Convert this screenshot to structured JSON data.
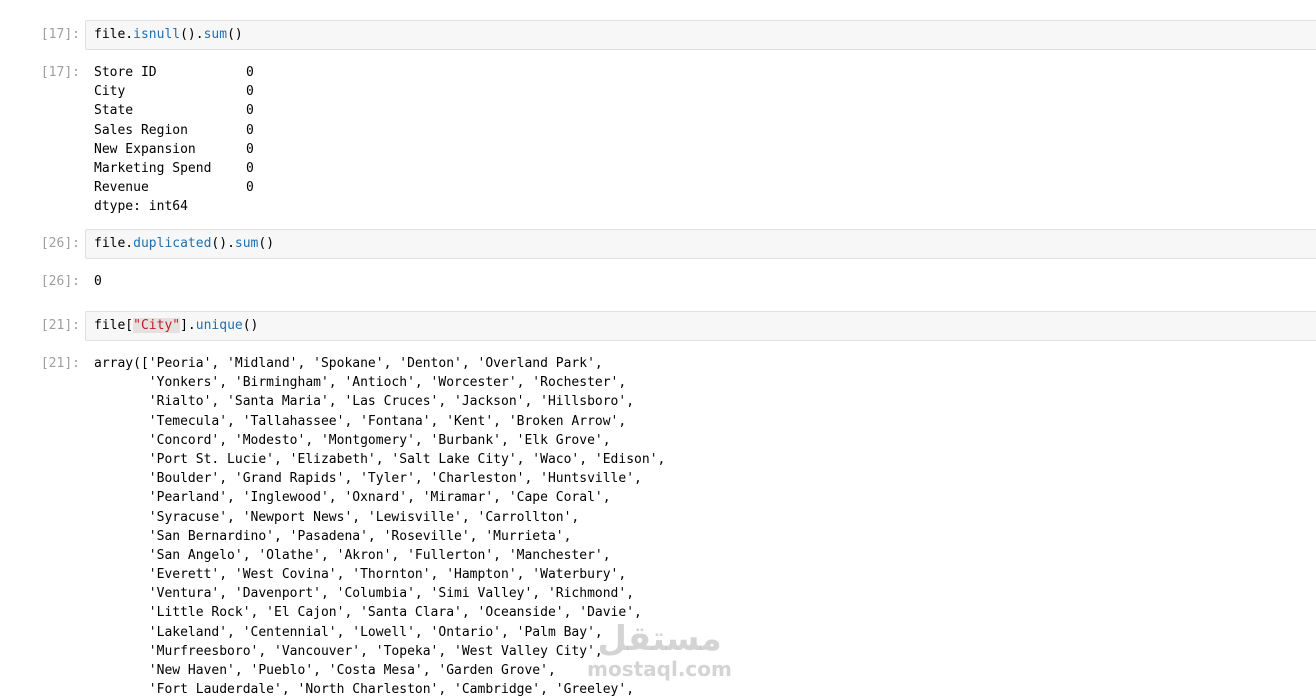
{
  "cells": [
    {
      "input_prompt": "[17]:",
      "input_code": {
        "obj": "file.",
        "fn1": "isnull",
        "mid": "().",
        "fn2": "sum",
        "end": "()"
      },
      "output_prompt": "[17]:",
      "output_rows": [
        {
          "name": "Store ID",
          "value": "0"
        },
        {
          "name": "City",
          "value": "0"
        },
        {
          "name": "State",
          "value": "0"
        },
        {
          "name": "Sales Region",
          "value": "0"
        },
        {
          "name": "New Expansion",
          "value": "0"
        },
        {
          "name": "Marketing Spend",
          "value": "0"
        },
        {
          "name": "Revenue",
          "value": "0"
        }
      ],
      "output_dtype": "dtype: int64"
    },
    {
      "input_prompt": "[26]:",
      "input_code": {
        "obj": "file.",
        "fn1": "duplicated",
        "mid": "().",
        "fn2": "sum",
        "end": "()"
      },
      "output_prompt": "[26]:",
      "output_value": "0"
    },
    {
      "input_prompt": "[21]:",
      "input_code": {
        "obj": "file[",
        "str": "\"City\"",
        "mid": "].",
        "fn": "unique",
        "end": "()"
      },
      "output_prompt": "[21]:",
      "output_lines": [
        "array(['Peoria', 'Midland', 'Spokane', 'Denton', 'Overland Park',",
        "       'Yonkers', 'Birmingham', 'Antioch', 'Worcester', 'Rochester',",
        "       'Rialto', 'Santa Maria', 'Las Cruces', 'Jackson', 'Hillsboro',",
        "       'Temecula', 'Tallahassee', 'Fontana', 'Kent', 'Broken Arrow',",
        "       'Concord', 'Modesto', 'Montgomery', 'Burbank', 'Elk Grove',",
        "       'Port St. Lucie', 'Elizabeth', 'Salt Lake City', 'Waco', 'Edison',",
        "       'Boulder', 'Grand Rapids', 'Tyler', 'Charleston', 'Huntsville',",
        "       'Pearland', 'Inglewood', 'Oxnard', 'Miramar', 'Cape Coral',",
        "       'Syracuse', 'Newport News', 'Lewisville', 'Carrollton',",
        "       'San Bernardino', 'Pasadena', 'Roseville', 'Murrieta',",
        "       'San Angelo', 'Olathe', 'Akron', 'Fullerton', 'Manchester',",
        "       'Everett', 'West Covina', 'Thornton', 'Hampton', 'Waterbury',",
        "       'Ventura', 'Davenport', 'Columbia', 'Simi Valley', 'Richmond',",
        "       'Little Rock', 'El Cajon', 'Santa Clara', 'Oceanside', 'Davie',",
        "       'Lakeland', 'Centennial', 'Lowell', 'Ontario', 'Palm Bay',",
        "       'Murfreesboro', 'Vancouver', 'Topeka', 'West Valley City',",
        "       'New Haven', 'Pueblo', 'Costa Mesa', 'Garden Grove',",
        "       'Fort Lauderdale', 'North Charleston', 'Cambridge', 'Greeley',"
      ]
    }
  ],
  "watermark": {
    "arabic": "مستقل",
    "latin": "mostaql.com"
  },
  "colors": {
    "function": "#1f6fb2",
    "string": "#ba2121",
    "prompt": "#9e9e9e",
    "input_bg": "#f7f7f7"
  }
}
